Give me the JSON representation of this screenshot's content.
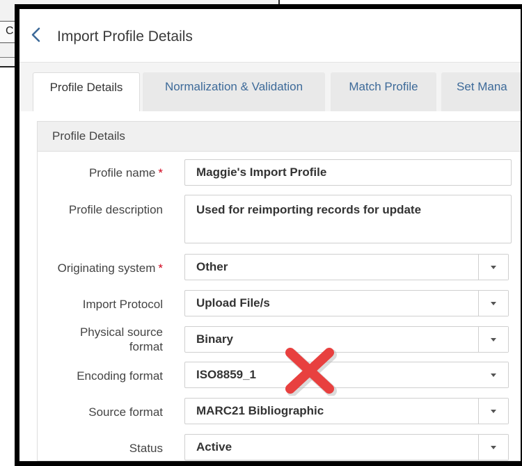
{
  "background_window": {
    "visible_char": "C"
  },
  "header": {
    "title": "Import Profile Details"
  },
  "tabs": [
    {
      "label": "Profile Details",
      "active": true
    },
    {
      "label": "Normalization & Validation",
      "active": false
    },
    {
      "label": "Match Profile",
      "active": false
    },
    {
      "label": "Set Mana",
      "active": false
    }
  ],
  "section": {
    "title": "Profile Details"
  },
  "fields": {
    "profile_name": {
      "label": "Profile name",
      "value": "Maggie's Import Profile",
      "required": "*"
    },
    "profile_description": {
      "label": "Profile description",
      "value": "Used for reimporting records for update"
    },
    "originating_system": {
      "label": "Originating system",
      "value": "Other",
      "required": "*"
    },
    "import_protocol": {
      "label": "Import Protocol",
      "value": "Upload File/s"
    },
    "physical_source_format": {
      "label_line1": "Physical source",
      "label_line2": "format",
      "value": "Binary"
    },
    "encoding_format": {
      "label": "Encoding format",
      "value": "ISO8859_1"
    },
    "source_format": {
      "label": "Source format",
      "value": "MARC21 Bibliographic"
    },
    "status": {
      "label": "Status",
      "value": "Active"
    }
  },
  "colors": {
    "accent": "#3d6a99",
    "required": "#d0021b",
    "annotation": "#e8403f"
  }
}
